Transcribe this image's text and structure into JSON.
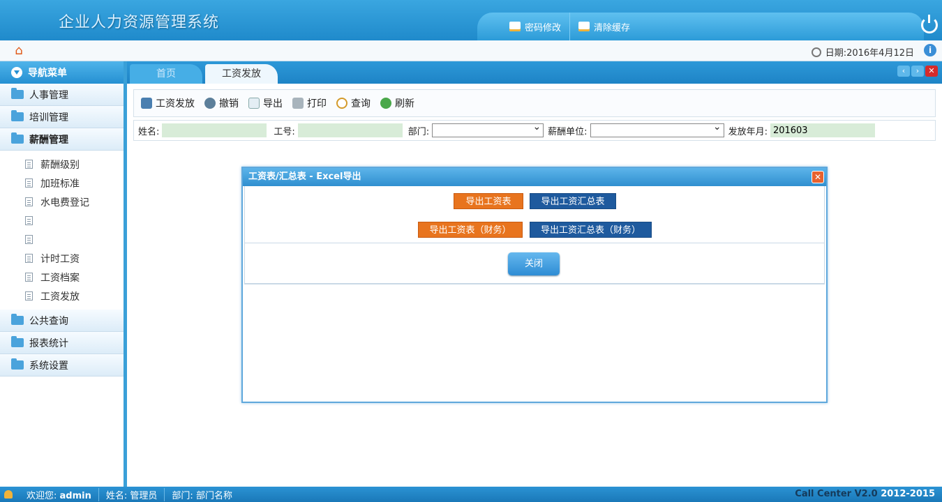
{
  "header": {
    "title": "企业人力资源管理系统",
    "buttons": [
      {
        "label": "密码修改",
        "icon": "key-icon"
      },
      {
        "label": "清除缓存",
        "icon": "clear-cache-icon"
      }
    ],
    "power_icon": "power-icon"
  },
  "strip": {
    "date_text": "日期:2016年4月12日",
    "home_icon": "home-icon",
    "info_icon": "info-icon"
  },
  "sidebar": {
    "header": "导航菜单",
    "sections": [
      {
        "label": "人事管理"
      },
      {
        "label": "培训管理"
      },
      {
        "label": "薪酬管理",
        "active": true,
        "items": [
          "薪酬级别",
          "加班标准",
          "水电费登记",
          "",
          "",
          "计时工资",
          "工资档案",
          "工资发放"
        ]
      },
      {
        "label": "公共查询"
      },
      {
        "label": "报表统计"
      },
      {
        "label": "系统设置"
      }
    ]
  },
  "tabs": [
    {
      "label": "首页",
      "active": false
    },
    {
      "label": "工资发放",
      "active": true
    }
  ],
  "toolbar": {
    "items": [
      "工资发放",
      "撤销",
      "导出",
      "打印",
      "查询",
      "刷新"
    ]
  },
  "filter": {
    "name_label": "姓名:",
    "name_value": "",
    "id_label": "工号:",
    "id_value": "",
    "dept_label": "部门:",
    "dept_value": "",
    "unit_label": "薪酬单位:",
    "unit_value": "",
    "month_label": "发放年月:",
    "month_value": "201603"
  },
  "dialog": {
    "title": "工资表/汇总表 - Excel导出",
    "btn_salary": "导出工资表",
    "btn_summary": "导出工资汇总表",
    "btn_salary_fin": "导出工资表（财务）",
    "btn_summary_fin": "导出工资汇总表（财务）",
    "close_label": "关闭"
  },
  "status": {
    "welcome_label": "欢迎您:",
    "user": "admin",
    "name_label": "姓名:",
    "name": "管理员",
    "dept_label": "部门:",
    "dept": "部门名称",
    "version": "Call Center V2.0",
    "years": "2012-2015"
  },
  "colors": {
    "primary_blue": "#2590d2",
    "orange_button": "#e8741e",
    "dark_blue_button": "#1e5a9e",
    "close_red": "#d62b2b"
  }
}
